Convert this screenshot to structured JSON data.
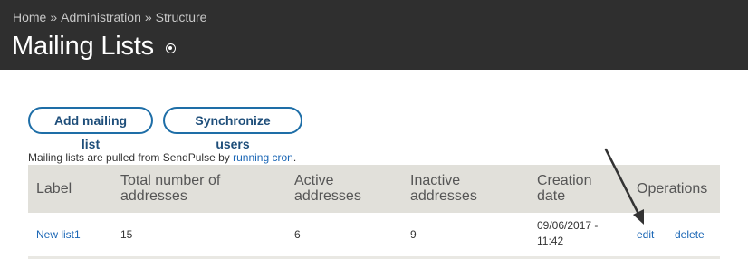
{
  "breadcrumb": {
    "items": [
      "Home",
      "Administration",
      "Structure"
    ],
    "separator": "»"
  },
  "page": {
    "title": "Mailing Lists",
    "shortcut_icon": "circle-dot-icon"
  },
  "actions": {
    "add_label": "Add mailing list",
    "sync_label": "Synchronize users"
  },
  "note": {
    "prefix": "Mailing lists are pulled from SendPulse by ",
    "link": "running cron",
    "suffix": "."
  },
  "table": {
    "headers": {
      "label": "Label",
      "total_line1": "Total number of",
      "total_line2": "addresses",
      "active_line1": "Active",
      "active_line2": "addresses",
      "inactive_line1": "Inactive",
      "inactive_line2": "addresses",
      "created_line1": "Creation",
      "created_line2": "date",
      "operations": "Operations"
    },
    "rows": [
      {
        "label": "New list1",
        "total": "15",
        "active": "6",
        "inactive": "9",
        "date_line1": "09/06/2017 -",
        "date_line2": "11:42",
        "edit": "edit",
        "delete": "delete"
      }
    ]
  },
  "colors": {
    "header_bg": "#2f2f2f",
    "table_header_bg": "#e1e0da",
    "link": "#1a66b5",
    "button_border": "#1e6ea7"
  }
}
